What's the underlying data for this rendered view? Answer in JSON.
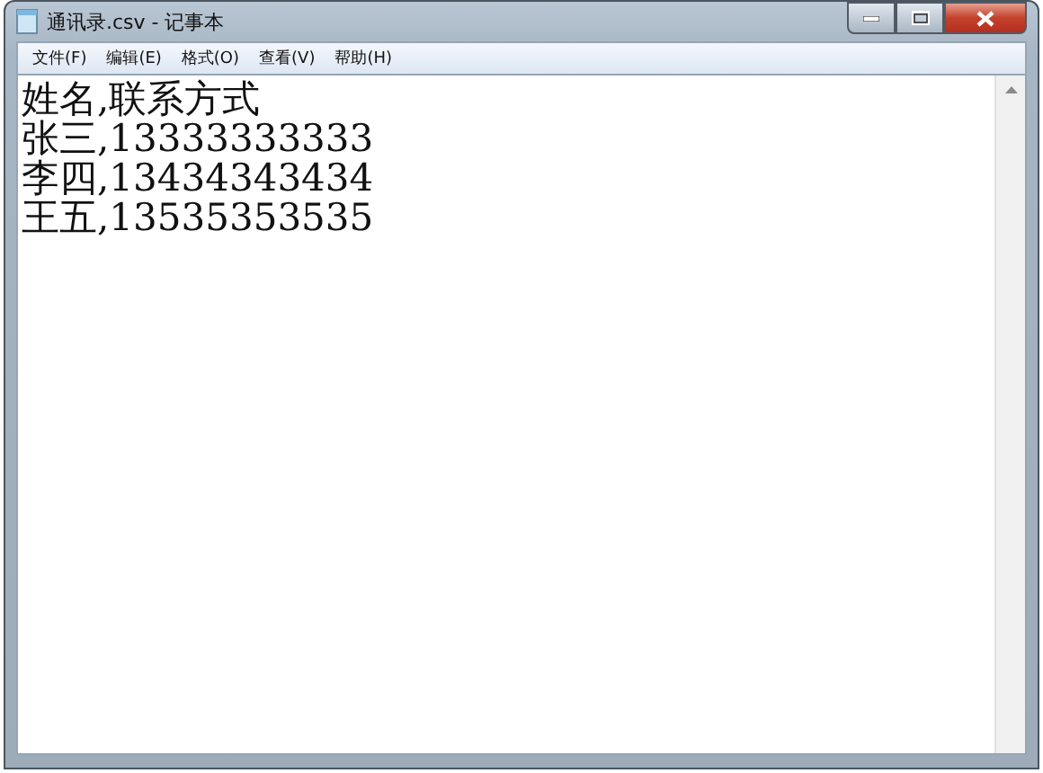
{
  "window": {
    "title": "通讯录.csv - 记事本"
  },
  "menu": [
    "文件(F)",
    "编辑(E)",
    "格式(O)",
    "查看(V)",
    "帮助(H)"
  ],
  "document": {
    "lines": [
      "姓名,联系方式",
      "张三,13333333333",
      "李四,13434343434",
      "王五,13535353535"
    ]
  }
}
